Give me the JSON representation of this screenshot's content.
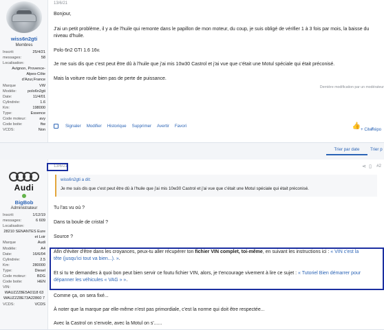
{
  "post1": {
    "user": {
      "name": "wiss6n2gti",
      "role": "Membres",
      "info": [
        {
          "k": "Inscrit:",
          "v": "25/4/21"
        },
        {
          "k": "messages:",
          "v": "58"
        },
        {
          "k": "Localisation:",
          "v": "Avignon, Provence-Alpes-Côte d'Azur,France"
        },
        {
          "k": "Marque",
          "v": "VW"
        },
        {
          "k": "Modèle:",
          "v": "polo6n2gti"
        },
        {
          "k": "Date:",
          "v": "11/4/01"
        },
        {
          "k": "Cylindrée:",
          "v": "1.6"
        },
        {
          "k": "Km:",
          "v": "198000"
        },
        {
          "k": "Type:",
          "v": "Essence"
        },
        {
          "k": "Code moteur:",
          "v": "avy"
        },
        {
          "k": "Code boite:",
          "v": "ftw"
        },
        {
          "k": "VCDS:",
          "v": "Non"
        }
      ]
    },
    "date": "13/6/21",
    "paragraphs": [
      "Bonjour,",
      "J'ai un petit problème, il y a de l'huile qui remonte dans le papillon de mon moteur, du coup, je suis obligé de vérifier 1 à 3 fois par mois, la baisse du",
      "niveau d'huile.",
      "Polo 6n2 GTI 1.6 16v.",
      "Je me suis dis que c'est peut être dû à l'huile que j'ai mis 10w30 Castrol et j'ai vue que c'était une Motul spéciale qui était préconisé.",
      "Mais la voiture roule bien pas de perte de puissance."
    ],
    "last_modified": "Dernière modification par un modérateur",
    "actions": [
      "Signaler",
      "Modifier",
      "Historique",
      "Supprimer",
      "Avertir",
      "Favori"
    ],
    "quote_label": "+ Citer",
    "reply_label": "Répo"
  },
  "sort": {
    "tab1": "Trier par date",
    "tab2": "Trier p"
  },
  "post2": {
    "user": {
      "name": "BigBob",
      "role": "Administrateur",
      "info": [
        {
          "k": "Inscrit:",
          "v": "1/12/19"
        },
        {
          "k": "messages:",
          "v": "6 609"
        },
        {
          "k": "Localisation:",
          "v": "28210 SENANTES Eure et Loir"
        },
        {
          "k": "Marque",
          "v": "Audi"
        },
        {
          "k": "Modèle:",
          "v": "A4"
        },
        {
          "k": "Date:",
          "v": "16/6/04"
        },
        {
          "k": "Cylindrée:",
          "v": "2.5"
        },
        {
          "k": "Km:",
          "v": "280000"
        },
        {
          "k": "Type:",
          "v": "Diesel"
        },
        {
          "k": "Code moteur:",
          "v": "BDG"
        },
        {
          "k": "Code boite:",
          "v": "HEN"
        },
        {
          "k": "VIN:",
          "v": "WAUZZZ8E5A0118 63"
        },
        {
          "k": "",
          "v": "WAUZZZ8E73A22860 7"
        },
        {
          "k": "VCDS:",
          "v": "VCDS"
        }
      ]
    },
    "logo_text": "Audi",
    "date": "13/6/21",
    "post_number": "#2",
    "quote": {
      "header": "wiss6n2gti a dit:",
      "text": "Je me suis dis que c'est peut être dû à l'huile que j'ai mis 10w30 Castrol et j'ai vue que c'était une Motul spéciale qui était préconisé."
    },
    "p1": "Tu l'as vu où ?",
    "p2": "Dans ta boule de cristal ?",
    "p3": "Source ?",
    "hl1a": "Afin d'éviter d'être dans les croyances, peux-tu aller récupérer ton ",
    "hl1b": "fichier VIN complet, toi-même",
    "hl1c": ", en suivant les instructions ici : ",
    "hl1link": "« VIN c'est la",
    "hl1link2": "tête (jusqu'ici tout va bien...). »",
    "hl1end": ".",
    "hl2a": "Et si tu te demandes à quoi bon peut bien servir ce foutu fichier VIN, alors, je t'encourage vivement à lire ce sujet : ",
    "hl2link": "« Tutoriel Bien démarrer pour",
    "hl2link2": "dépanner les véhicules « VAG » »",
    "hl2end": ".",
    "p4": "Comme ça, on sera fixé...",
    "p5": "À noter que la marque par elle-même n'est pas primordiale, c'est la norme qui doit être respectée...",
    "p6": "Avec la Castrol on s'envole, avec la Motul on s'......"
  },
  "colors": {
    "link": "#2a63b5",
    "highlight_border": "#1a2ea0",
    "quote_accent": "#e3a53a",
    "online": "#63b34a"
  }
}
